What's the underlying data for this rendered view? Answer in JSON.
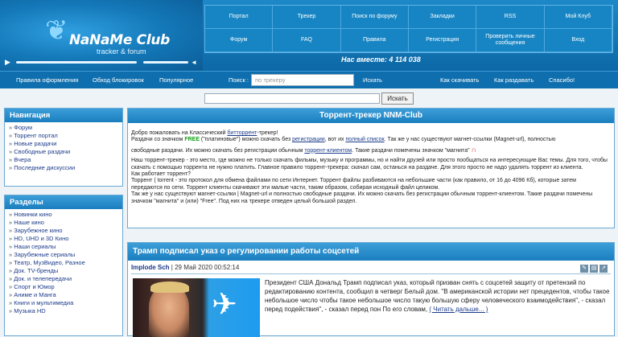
{
  "logo": {
    "title": "NaNaMe Club",
    "subtitle": "tracker & forum"
  },
  "nav": [
    "Портал",
    "Трекер",
    "Поиск по форуму",
    "Закладки",
    "RSS",
    "Мой Клуб",
    "Форум",
    "FAQ",
    "Правила",
    "Регистрация",
    "Проверить личные сообщения",
    "Вход"
  ],
  "online": "Нас вместе: 4 114 038",
  "menu": {
    "rules": "Правила оформления",
    "bypass": "Обход блокировок",
    "popular": "Популярное",
    "search_label": "Поиск :",
    "search_placeholder": "по трекеру",
    "search_btn": "Искать",
    "how_download": "Как скачивать",
    "how_seed": "Как раздавать",
    "thanks": "Спасибо!"
  },
  "search2_btn": "Искать",
  "navigation": {
    "title": "Навигация",
    "items": [
      "Форум",
      "Торрент портал",
      "Новые раздачи",
      "Свободные раздачи",
      "Вчера",
      "Последние дискуссии"
    ]
  },
  "sections": {
    "title": "Разделы",
    "items": [
      "Новинки кино",
      "Наше кино",
      "Зарубежное кино",
      "HD, UHD и 3D Кино",
      "Наши сериалы",
      "Зарубежные сериалы",
      "Театр, МузВидео, Разное",
      "Док. TV-бренды",
      "Док. и телепередачи",
      "Спорт и Юмор",
      "Аниме и Манга",
      "Книги и мультимедиа",
      "Музыка HD"
    ]
  },
  "main": {
    "title": "Торрент-трекер NNM-Club",
    "p1a": "Добро пожаловать на Классический ",
    "p1link": "битторрент",
    "p1b": "-трекер!",
    "p2a": "Раздачи со значком ",
    "p2free": "FREE",
    "p2b": " (\"платиновые\") можно скачать без ",
    "p2link1": "регистрации",
    "p2c": ", вот их ",
    "p2link2": "полный список",
    "p2d": ". Так же у нас существуют магнет-ссылки (Magnet-url), полностью",
    "p3a": "свободные раздачи. Их можно скачать без регистрации обычным ",
    "p3link": "торрент-клиентом",
    "p3b": ". Такие раздачи помечены значком \"магнита\"",
    "p4": "Наш торрент-трекер - это место, где можно не только скачать фильмы, музыку и программы, но и найти друзей или просто пообщаться на интересующие Вас темы. Для того, чтобы скачать с помощью торрента не нужно платить. Главное правило торрент-трекера: скачал сам, останься на раздаче. Для этого просто не надо удалять торрент из клиента.",
    "p5": "Как работает торрент?",
    "p6": "Торрент ( torrent - это протокол для обмена файлами по сети Интернет. Торрент файлы разбиваются на небольшие части (как правило, от 16 до 4096 Кб), которые затем передаются по сети. Торрент клиенты скачивают эти малые части, таким образом, собирая исходный файл целиком.",
    "p7": "Так же у нас существуют магнет-ссылки | Magnet-url и полностью свободные раздачи. Их можно скачать без регистрации обычным торрент-клиентом. Такие раздачи помечены значком \"магнита\" и (или) \"Free\". Под них на трекере отведен целый большой раздел."
  },
  "news": {
    "title": "Трамп подписал указ о регулировании работы соцсетей",
    "author": "Implode Sch",
    "date": "| 29 Май 2020 00:52:14",
    "text": "Президент США Дональд Трамп подписал указ, который призван снять с соцсетей защиту от претензий по редактированию контента, сообщил в четверг Белый дом. \"В американской истории нет прецедентов, чтобы такое небольшое число чтобы такое небольшое число такую большую сферу человеческого взаимодействия\", - сказал перед подействия\", - сказал перед пон По его словам,",
    "more": "( Читать дальше... )"
  }
}
